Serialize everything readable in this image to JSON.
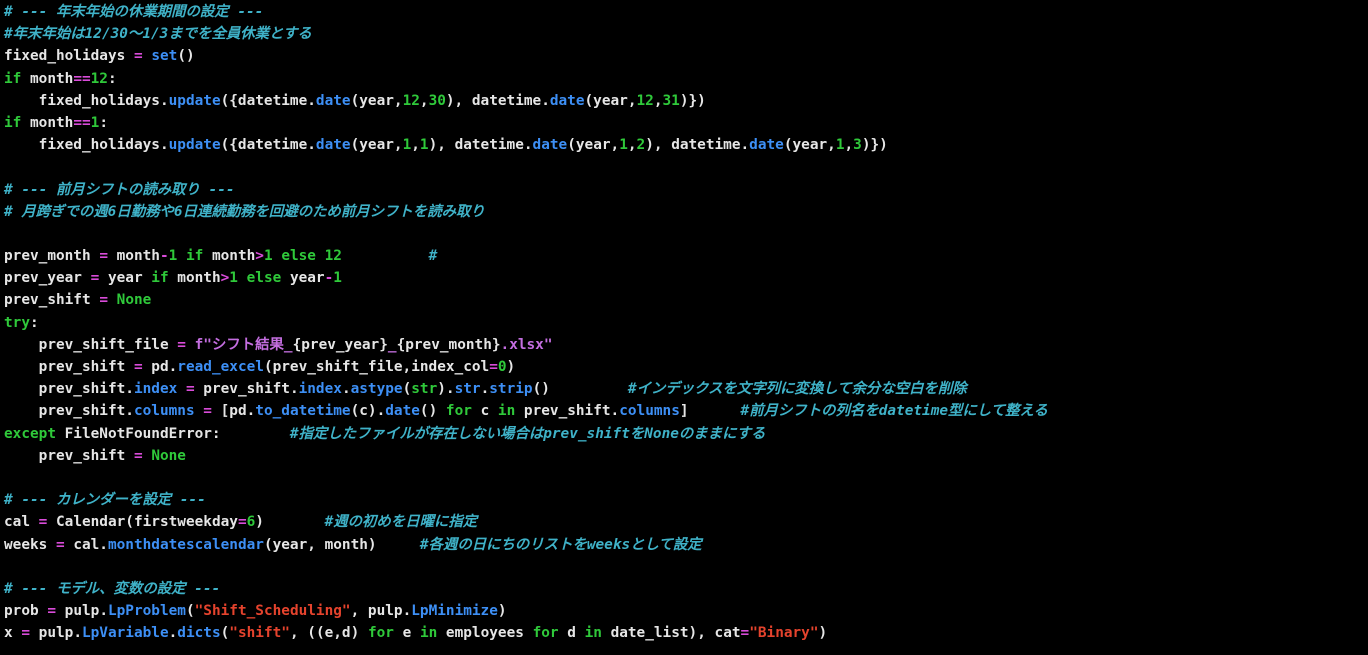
{
  "colors": {
    "background": "#000000",
    "plain": "#e6e6e6",
    "comment": "#3fb2c8",
    "keyword": "#2fc93a",
    "function": "#3d8ff5",
    "number": "#2fc93a",
    "string": "#e5432d",
    "operator": "#d94bd9",
    "fstring": "#c46ee0"
  },
  "lines": [
    [
      {
        "t": "c",
        "v": "# --- 年末年始の休業期間の設定 ---"
      }
    ],
    [
      {
        "t": "c",
        "v": "#年末年始は12/30～1/3までを全員休業とする"
      }
    ],
    [
      {
        "t": "p",
        "v": "fixed_holidays "
      },
      {
        "t": "o",
        "v": "="
      },
      {
        "t": "p",
        "v": " "
      },
      {
        "t": "f",
        "v": "set"
      },
      {
        "t": "p",
        "v": "()"
      }
    ],
    [
      {
        "t": "k",
        "v": "if"
      },
      {
        "t": "p",
        "v": " month"
      },
      {
        "t": "o",
        "v": "=="
      },
      {
        "t": "n",
        "v": "12"
      },
      {
        "t": "p",
        "v": ":"
      }
    ],
    [
      {
        "t": "p",
        "v": "    fixed_holidays."
      },
      {
        "t": "f",
        "v": "update"
      },
      {
        "t": "p",
        "v": "({datetime."
      },
      {
        "t": "f",
        "v": "date"
      },
      {
        "t": "p",
        "v": "(year,"
      },
      {
        "t": "n",
        "v": "12"
      },
      {
        "t": "p",
        "v": ","
      },
      {
        "t": "n",
        "v": "30"
      },
      {
        "t": "p",
        "v": "), datetime."
      },
      {
        "t": "f",
        "v": "date"
      },
      {
        "t": "p",
        "v": "(year,"
      },
      {
        "t": "n",
        "v": "12"
      },
      {
        "t": "p",
        "v": ","
      },
      {
        "t": "n",
        "v": "31"
      },
      {
        "t": "p",
        "v": ")})"
      }
    ],
    [
      {
        "t": "k",
        "v": "if"
      },
      {
        "t": "p",
        "v": " month"
      },
      {
        "t": "o",
        "v": "=="
      },
      {
        "t": "n",
        "v": "1"
      },
      {
        "t": "p",
        "v": ":"
      }
    ],
    [
      {
        "t": "p",
        "v": "    fixed_holidays."
      },
      {
        "t": "f",
        "v": "update"
      },
      {
        "t": "p",
        "v": "({datetime."
      },
      {
        "t": "f",
        "v": "date"
      },
      {
        "t": "p",
        "v": "(year,"
      },
      {
        "t": "n",
        "v": "1"
      },
      {
        "t": "p",
        "v": ","
      },
      {
        "t": "n",
        "v": "1"
      },
      {
        "t": "p",
        "v": "), datetime."
      },
      {
        "t": "f",
        "v": "date"
      },
      {
        "t": "p",
        "v": "(year,"
      },
      {
        "t": "n",
        "v": "1"
      },
      {
        "t": "p",
        "v": ","
      },
      {
        "t": "n",
        "v": "2"
      },
      {
        "t": "p",
        "v": "), datetime."
      },
      {
        "t": "f",
        "v": "date"
      },
      {
        "t": "p",
        "v": "(year,"
      },
      {
        "t": "n",
        "v": "1"
      },
      {
        "t": "p",
        "v": ","
      },
      {
        "t": "n",
        "v": "3"
      },
      {
        "t": "p",
        "v": ")})"
      }
    ],
    [],
    [
      {
        "t": "c",
        "v": "# --- 前月シフトの読み取り ---"
      }
    ],
    [
      {
        "t": "c",
        "v": "# 月跨ぎでの週6日勤務や6日連続勤務を回避のため前月シフトを読み取り"
      }
    ],
    [],
    [
      {
        "t": "p",
        "v": "prev_month "
      },
      {
        "t": "o",
        "v": "="
      },
      {
        "t": "p",
        "v": " month"
      },
      {
        "t": "o",
        "v": "-"
      },
      {
        "t": "n",
        "v": "1"
      },
      {
        "t": "p",
        "v": " "
      },
      {
        "t": "k",
        "v": "if"
      },
      {
        "t": "p",
        "v": " month"
      },
      {
        "t": "o",
        "v": ">"
      },
      {
        "t": "n",
        "v": "1"
      },
      {
        "t": "p",
        "v": " "
      },
      {
        "t": "k",
        "v": "else"
      },
      {
        "t": "p",
        "v": " "
      },
      {
        "t": "n",
        "v": "12"
      },
      {
        "t": "p",
        "v": "          "
      },
      {
        "t": "c",
        "v": "#"
      }
    ],
    [
      {
        "t": "p",
        "v": "prev_year "
      },
      {
        "t": "o",
        "v": "="
      },
      {
        "t": "p",
        "v": " year "
      },
      {
        "t": "k",
        "v": "if"
      },
      {
        "t": "p",
        "v": " month"
      },
      {
        "t": "o",
        "v": ">"
      },
      {
        "t": "n",
        "v": "1"
      },
      {
        "t": "p",
        "v": " "
      },
      {
        "t": "k",
        "v": "else"
      },
      {
        "t": "p",
        "v": " year"
      },
      {
        "t": "o",
        "v": "-"
      },
      {
        "t": "n",
        "v": "1"
      }
    ],
    [
      {
        "t": "p",
        "v": "prev_shift "
      },
      {
        "t": "o",
        "v": "="
      },
      {
        "t": "p",
        "v": " "
      },
      {
        "t": "k",
        "v": "None"
      }
    ],
    [
      {
        "t": "k",
        "v": "try"
      },
      {
        "t": "p",
        "v": ":"
      }
    ],
    [
      {
        "t": "p",
        "v": "    prev_shift_file "
      },
      {
        "t": "o",
        "v": "="
      },
      {
        "t": "p",
        "v": " "
      },
      {
        "t": "fs",
        "v": "f\"シフト結果_"
      },
      {
        "t": "p",
        "v": "{prev_year}"
      },
      {
        "t": "fs",
        "v": "_"
      },
      {
        "t": "p",
        "v": "{prev_month}"
      },
      {
        "t": "fs",
        "v": ".xlsx\""
      }
    ],
    [
      {
        "t": "p",
        "v": "    prev_shift "
      },
      {
        "t": "o",
        "v": "="
      },
      {
        "t": "p",
        "v": " pd."
      },
      {
        "t": "f",
        "v": "read_excel"
      },
      {
        "t": "p",
        "v": "(prev_shift_file,index_col"
      },
      {
        "t": "o",
        "v": "="
      },
      {
        "t": "n",
        "v": "0"
      },
      {
        "t": "p",
        "v": ")"
      }
    ],
    [
      {
        "t": "p",
        "v": "    prev_shift."
      },
      {
        "t": "f",
        "v": "index"
      },
      {
        "t": "p",
        "v": " "
      },
      {
        "t": "o",
        "v": "="
      },
      {
        "t": "p",
        "v": " prev_shift."
      },
      {
        "t": "f",
        "v": "index"
      },
      {
        "t": "p",
        "v": "."
      },
      {
        "t": "f",
        "v": "astype"
      },
      {
        "t": "p",
        "v": "("
      },
      {
        "t": "n",
        "v": "str"
      },
      {
        "t": "p",
        "v": ")."
      },
      {
        "t": "f",
        "v": "str"
      },
      {
        "t": "p",
        "v": "."
      },
      {
        "t": "f",
        "v": "strip"
      },
      {
        "t": "p",
        "v": "()         "
      },
      {
        "t": "c",
        "v": "#インデックスを文字列に変換して余分な空白を削除"
      }
    ],
    [
      {
        "t": "p",
        "v": "    prev_shift."
      },
      {
        "t": "f",
        "v": "columns"
      },
      {
        "t": "p",
        "v": " "
      },
      {
        "t": "o",
        "v": "="
      },
      {
        "t": "p",
        "v": " [pd."
      },
      {
        "t": "f",
        "v": "to_datetime"
      },
      {
        "t": "p",
        "v": "(c)."
      },
      {
        "t": "f",
        "v": "date"
      },
      {
        "t": "p",
        "v": "() "
      },
      {
        "t": "k",
        "v": "for"
      },
      {
        "t": "p",
        "v": " c "
      },
      {
        "t": "k",
        "v": "in"
      },
      {
        "t": "p",
        "v": " prev_shift."
      },
      {
        "t": "f",
        "v": "columns"
      },
      {
        "t": "p",
        "v": "]      "
      },
      {
        "t": "c",
        "v": "#前月シフトの列名をdatetime型にして整える"
      }
    ],
    [
      {
        "t": "k",
        "v": "except"
      },
      {
        "t": "p",
        "v": " FileNotFoundError:        "
      },
      {
        "t": "c",
        "v": "#指定したファイルが存在しない場合はprev_shiftをNoneのままにする"
      }
    ],
    [
      {
        "t": "p",
        "v": "    prev_shift "
      },
      {
        "t": "o",
        "v": "="
      },
      {
        "t": "p",
        "v": " "
      },
      {
        "t": "k",
        "v": "None"
      }
    ],
    [],
    [
      {
        "t": "c",
        "v": "# --- カレンダーを設定 ---"
      }
    ],
    [
      {
        "t": "p",
        "v": "cal "
      },
      {
        "t": "o",
        "v": "="
      },
      {
        "t": "p",
        "v": " Calendar(firstweekday"
      },
      {
        "t": "o",
        "v": "="
      },
      {
        "t": "n",
        "v": "6"
      },
      {
        "t": "p",
        "v": ")       "
      },
      {
        "t": "c",
        "v": "#週の初めを日曜に指定"
      }
    ],
    [
      {
        "t": "p",
        "v": "weeks "
      },
      {
        "t": "o",
        "v": "="
      },
      {
        "t": "p",
        "v": " cal."
      },
      {
        "t": "f",
        "v": "monthdatescalendar"
      },
      {
        "t": "p",
        "v": "(year, month)     "
      },
      {
        "t": "c",
        "v": "#各週の日にちのリストをweeksとして設定"
      }
    ],
    [],
    [
      {
        "t": "c",
        "v": "# --- モデル、変数の設定 ---"
      }
    ],
    [
      {
        "t": "p",
        "v": "prob "
      },
      {
        "t": "o",
        "v": "="
      },
      {
        "t": "p",
        "v": " pulp."
      },
      {
        "t": "f",
        "v": "LpProblem"
      },
      {
        "t": "p",
        "v": "("
      },
      {
        "t": "s",
        "v": "\"Shift_Scheduling\""
      },
      {
        "t": "p",
        "v": ", pulp."
      },
      {
        "t": "f",
        "v": "LpMinimize"
      },
      {
        "t": "p",
        "v": ")"
      }
    ],
    [
      {
        "t": "p",
        "v": "x "
      },
      {
        "t": "o",
        "v": "="
      },
      {
        "t": "p",
        "v": " pulp."
      },
      {
        "t": "f",
        "v": "LpVariable"
      },
      {
        "t": "p",
        "v": "."
      },
      {
        "t": "f",
        "v": "dicts"
      },
      {
        "t": "p",
        "v": "("
      },
      {
        "t": "s",
        "v": "\"shift\""
      },
      {
        "t": "p",
        "v": ", ((e,d) "
      },
      {
        "t": "k",
        "v": "for"
      },
      {
        "t": "p",
        "v": " e "
      },
      {
        "t": "k",
        "v": "in"
      },
      {
        "t": "p",
        "v": " employees "
      },
      {
        "t": "k",
        "v": "for"
      },
      {
        "t": "p",
        "v": " d "
      },
      {
        "t": "k",
        "v": "in"
      },
      {
        "t": "p",
        "v": " date_list), cat"
      },
      {
        "t": "o",
        "v": "="
      },
      {
        "t": "s",
        "v": "\"Binary\""
      },
      {
        "t": "p",
        "v": ")"
      }
    ]
  ]
}
